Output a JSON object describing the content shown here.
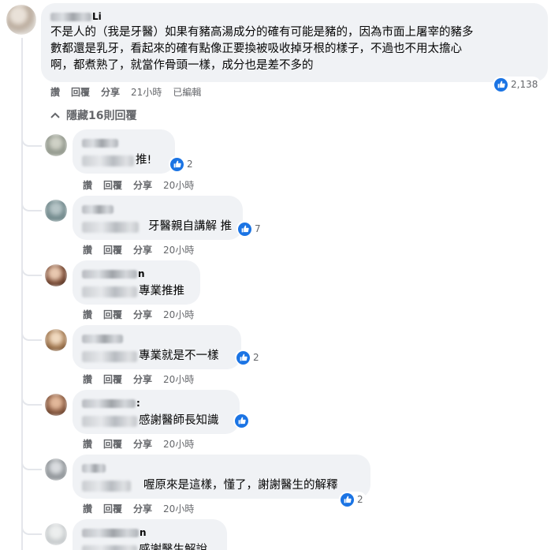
{
  "main_comment": {
    "author_suffix": "Li",
    "text_line1": "不是人的（我是牙醫）如果有豬高湯成分的確有可能是豬的，因為市面上屠宰的豬多",
    "text_line2": "數都還是乳牙，看起來的確有點像正要換被吸收掉牙根的樣子，不過也不用太擔心",
    "text_line3": "啊，都煮熟了，就當作骨頭一樣，成分也是差不多的",
    "likes": "2,138",
    "actions": {
      "like": "讚",
      "reply": "回覆",
      "share": "分享",
      "time": "21小時",
      "edited": "已編輯"
    }
  },
  "toggle_replies": "隱藏16則回覆",
  "replies": [
    {
      "name_suffix": "",
      "text": "推!",
      "likes": "2",
      "actions": {
        "like": "讚",
        "reply": "回覆",
        "share": "分享",
        "time": "20小時"
      }
    },
    {
      "name_suffix": "",
      "text": "牙醫親自講解 推",
      "likes": "7",
      "actions": {
        "like": "讚",
        "reply": "回覆",
        "share": "分享",
        "time": "20小時"
      }
    },
    {
      "name_suffix": "n",
      "text": "專業推推",
      "likes": "",
      "actions": {
        "like": "讚",
        "reply": "回覆",
        "share": "分享",
        "time": "20小時"
      }
    },
    {
      "name_suffix": "",
      "text": "專業就是不一樣",
      "likes": "2",
      "actions": {
        "like": "讚",
        "reply": "回覆",
        "share": "分享",
        "time": "20小時"
      }
    },
    {
      "name_suffix": ":",
      "text": "感謝醫師長知識",
      "likes": "",
      "actions": {
        "like": "讚",
        "reply": "回覆",
        "share": "分享",
        "time": "20小時"
      }
    },
    {
      "name_suffix": "",
      "text": "喔原來是這樣，懂了，謝謝醫生的解釋",
      "likes": "2",
      "actions": {
        "like": "讚",
        "reply": "回覆",
        "share": "分享",
        "time": "20小時"
      }
    },
    {
      "name_suffix": "n",
      "text": "感謝醫生解說",
      "likes": "",
      "actions": {}
    }
  ],
  "colors": {
    "like_blue": "#1b74e4",
    "bubble": "#f0f2f5",
    "meta": "#65676b"
  },
  "icons": {
    "like": "thumbs-up-icon",
    "collapse": "chevron-up-icon"
  }
}
